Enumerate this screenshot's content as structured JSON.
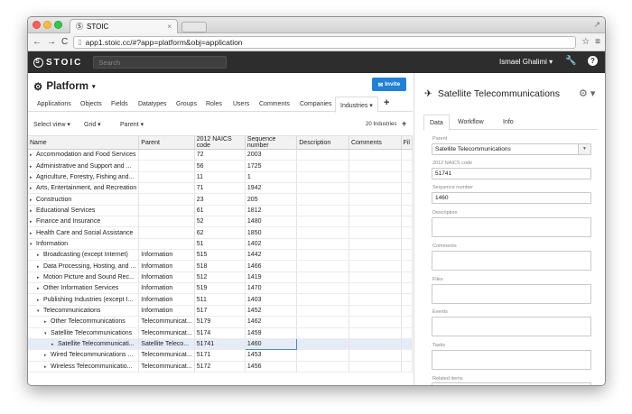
{
  "browser": {
    "tab_title": "STOIC",
    "tab_close": "×",
    "url": "app1.stoic.cc/#?app=platform&obj=application",
    "back_icon": "←",
    "forward_icon": "→",
    "reload_icon": "C",
    "star_icon": "☆",
    "menu_icon": "≡",
    "resize_icon": "↗"
  },
  "appbar": {
    "logo_text": "STOIC",
    "logo_mark": "S",
    "search_placeholder": "Search",
    "user_name": "Ismael Ghalimi ▾",
    "wrench_icon": "🔧",
    "help_icon": "?"
  },
  "left": {
    "title": "Platform",
    "title_icon": "⚙",
    "title_caret": "▾",
    "invite_label": "Invite",
    "invite_icon": "✉",
    "tabs": [
      "Applications",
      "Objects",
      "Fields",
      "Datatypes",
      "Groups",
      "Roles",
      "Users",
      "Comments",
      "Companies",
      "Industries ▾"
    ],
    "add_tab": "+",
    "toolbar": {
      "select_view": "Select view ▾",
      "grid": "Grid ▾",
      "parent": "Parent ▾",
      "count": "20 Industries",
      "add": "+"
    },
    "columns": [
      "Name",
      "Parent",
      "2012 NAICS code",
      "Sequence number",
      "Description",
      "Comments",
      "Fil"
    ],
    "rows": [
      {
        "arrow": "▸",
        "name": "Accommodation and Food Services",
        "parent": "",
        "code": "72",
        "seq": "2003"
      },
      {
        "arrow": "▸",
        "name": "Administrative and Support and ...",
        "parent": "",
        "code": "56",
        "seq": "1725"
      },
      {
        "arrow": "▸",
        "name": "Agriculture, Forestry, Fishing and...",
        "parent": "",
        "code": "11",
        "seq": "1"
      },
      {
        "arrow": "▸",
        "name": "Arts, Entertainment, and Recreation",
        "parent": "",
        "code": "71",
        "seq": "1942"
      },
      {
        "arrow": "▸",
        "name": "Construction",
        "parent": "",
        "code": "23",
        "seq": "205"
      },
      {
        "arrow": "▸",
        "name": "Educational Services",
        "parent": "",
        "code": "61",
        "seq": "1812"
      },
      {
        "arrow": "▸",
        "name": "Finance and Insurance",
        "parent": "",
        "code": "52",
        "seq": "1480"
      },
      {
        "arrow": "▸",
        "name": "Health Care and Social Assistance",
        "parent": "",
        "code": "62",
        "seq": "1850"
      },
      {
        "arrow": "▾",
        "name": "Information",
        "parent": "",
        "code": "51",
        "seq": "1402"
      },
      {
        "arrow": "▸",
        "name": "Broadcasting (except Internet)",
        "parent": "Information",
        "code": "515",
        "seq": "1442"
      },
      {
        "arrow": "▸",
        "name": "Data Processing, Hosting, and ...",
        "parent": "Information",
        "code": "518",
        "seq": "1466"
      },
      {
        "arrow": "▸",
        "name": "Motion Picture and Sound Rec...",
        "parent": "Information",
        "code": "512",
        "seq": "1419"
      },
      {
        "arrow": "▸",
        "name": "Other Information Services",
        "parent": "Information",
        "code": "519",
        "seq": "1470"
      },
      {
        "arrow": "▸",
        "name": "Publishing Industries (except I...",
        "parent": "Information",
        "code": "511",
        "seq": "1403"
      },
      {
        "arrow": "▾",
        "name": "Telecommunications",
        "parent": "Information",
        "code": "517",
        "seq": "1452"
      },
      {
        "arrow": "▸",
        "name": "Other Telecommunications",
        "parent": "Telecommunicat...",
        "code": "5179",
        "seq": "1462"
      },
      {
        "arrow": "▾",
        "name": "Satellite Telecommunications",
        "parent": "Telecommunicat...",
        "code": "5174",
        "seq": "1459"
      },
      {
        "arrow": "▸",
        "name": "Satellite Telecommunicati...",
        "parent": "Satellite Teleco...",
        "code": "51741",
        "seq": "1460"
      },
      {
        "arrow": "▸",
        "name": "Wired Telecommunications ...",
        "parent": "Telecommunicat...",
        "code": "5171",
        "seq": "1453"
      },
      {
        "arrow": "▸",
        "name": "Wireless Telecommunicatio...",
        "parent": "Telecommunicat...",
        "code": "5172",
        "seq": "1456"
      }
    ]
  },
  "right": {
    "title": "Satellite Telecommunications",
    "title_icon": "✈",
    "gear_icon": "⚙ ▾",
    "tabs": [
      "Data",
      "Workflow",
      "Info"
    ],
    "fields": {
      "parent_label": "Parent",
      "parent_value": "Satellite Telecommunications",
      "code_label": "2012 NAICS code",
      "code_value": "51741",
      "seq_label": "Sequence number",
      "seq_value": "1460",
      "description_label": "Description",
      "comments_label": "Comments",
      "files_label": "Files",
      "events_label": "Events",
      "tasks_label": "Tasks",
      "related_label": "Related items"
    }
  },
  "colors": {
    "accent": "#2181d6",
    "appbar": "#2d2d2d",
    "selection": "#e6ecf7"
  }
}
